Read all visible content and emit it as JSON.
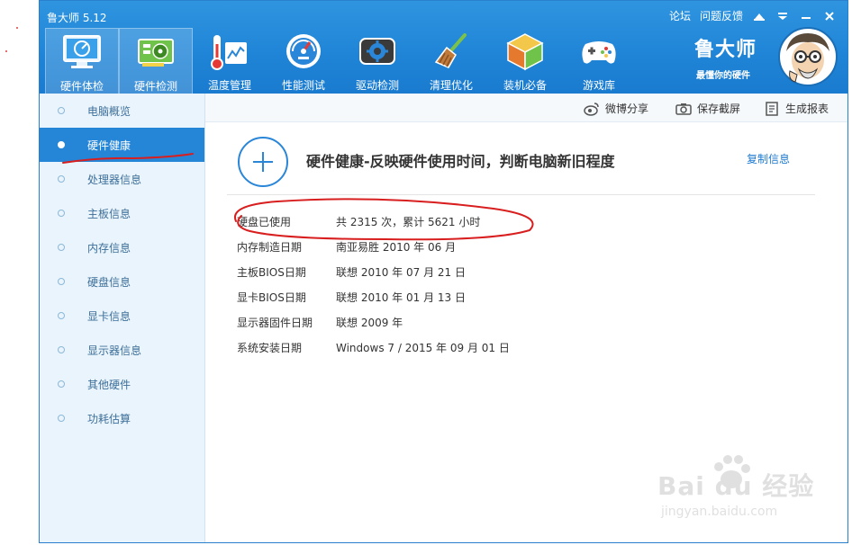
{
  "app": {
    "title": "鲁大师 5.12",
    "top_links": [
      "论坛",
      "问题反馈"
    ],
    "controls": [
      "skin-icon",
      "menu-icon",
      "minimize-icon",
      "close-icon"
    ]
  },
  "nav": {
    "items": [
      {
        "label": "硬件体检",
        "icon": "monitor-gauge-icon",
        "selected": true
      },
      {
        "label": "硬件检测",
        "icon": "graphics-card-icon",
        "selected": true
      },
      {
        "label": "温度管理",
        "icon": "thermometer-icon",
        "selected": false
      },
      {
        "label": "性能测试",
        "icon": "speedometer-icon",
        "selected": false
      },
      {
        "label": "驱动检测",
        "icon": "driver-gear-icon",
        "selected": false
      },
      {
        "label": "清理优化",
        "icon": "broom-icon",
        "selected": false
      },
      {
        "label": "装机必备",
        "icon": "cube-box-icon",
        "selected": false
      },
      {
        "label": "游戏库",
        "icon": "gamepad-icon",
        "selected": false
      }
    ]
  },
  "brand": {
    "name": "鲁大师",
    "slogan": "最懂你的硬件"
  },
  "sidebar": {
    "items": [
      {
        "label": "电脑概览",
        "selected": false
      },
      {
        "label": "硬件健康",
        "selected": true
      },
      {
        "label": "处理器信息",
        "selected": false
      },
      {
        "label": "主板信息",
        "selected": false
      },
      {
        "label": "内存信息",
        "selected": false
      },
      {
        "label": "硬盘信息",
        "selected": false
      },
      {
        "label": "显卡信息",
        "selected": false
      },
      {
        "label": "显示器信息",
        "selected": false
      },
      {
        "label": "其他硬件",
        "selected": false
      },
      {
        "label": "功耗估算",
        "selected": false
      }
    ]
  },
  "toolbar": {
    "weibo_label": "微博分享",
    "screenshot_label": "保存截屏",
    "report_label": "生成报表"
  },
  "main": {
    "heading": "硬件健康-反映硬件使用时间，判断电脑新旧程度",
    "copy_label": "复制信息",
    "rows": [
      {
        "key": "硬盘已使用",
        "value": "共 2315 次，累计 5621 小时"
      },
      {
        "key": "内存制造日期",
        "value": "南亚易胜 2010 年 06 月"
      },
      {
        "key": "主板BIOS日期",
        "value": "联想 2010 年 07 月 21 日"
      },
      {
        "key": "显卡BIOS日期",
        "value": "联想 2010 年 01 月 13 日"
      },
      {
        "key": "显示器固件日期",
        "value": "联想 2009 年"
      },
      {
        "key": "系统安装日期",
        "value": "Windows 7 / 2015 年 09 月 01 日"
      }
    ]
  },
  "watermark": {
    "text": "Bai du 经验",
    "sub": "jingyan.baidu.com"
  },
  "colors": {
    "header_blue": "#1f84d6",
    "accent_blue": "#2586d8",
    "annotation_red": "#d81e1e",
    "sidebar_bg": "#eaf4fc"
  }
}
